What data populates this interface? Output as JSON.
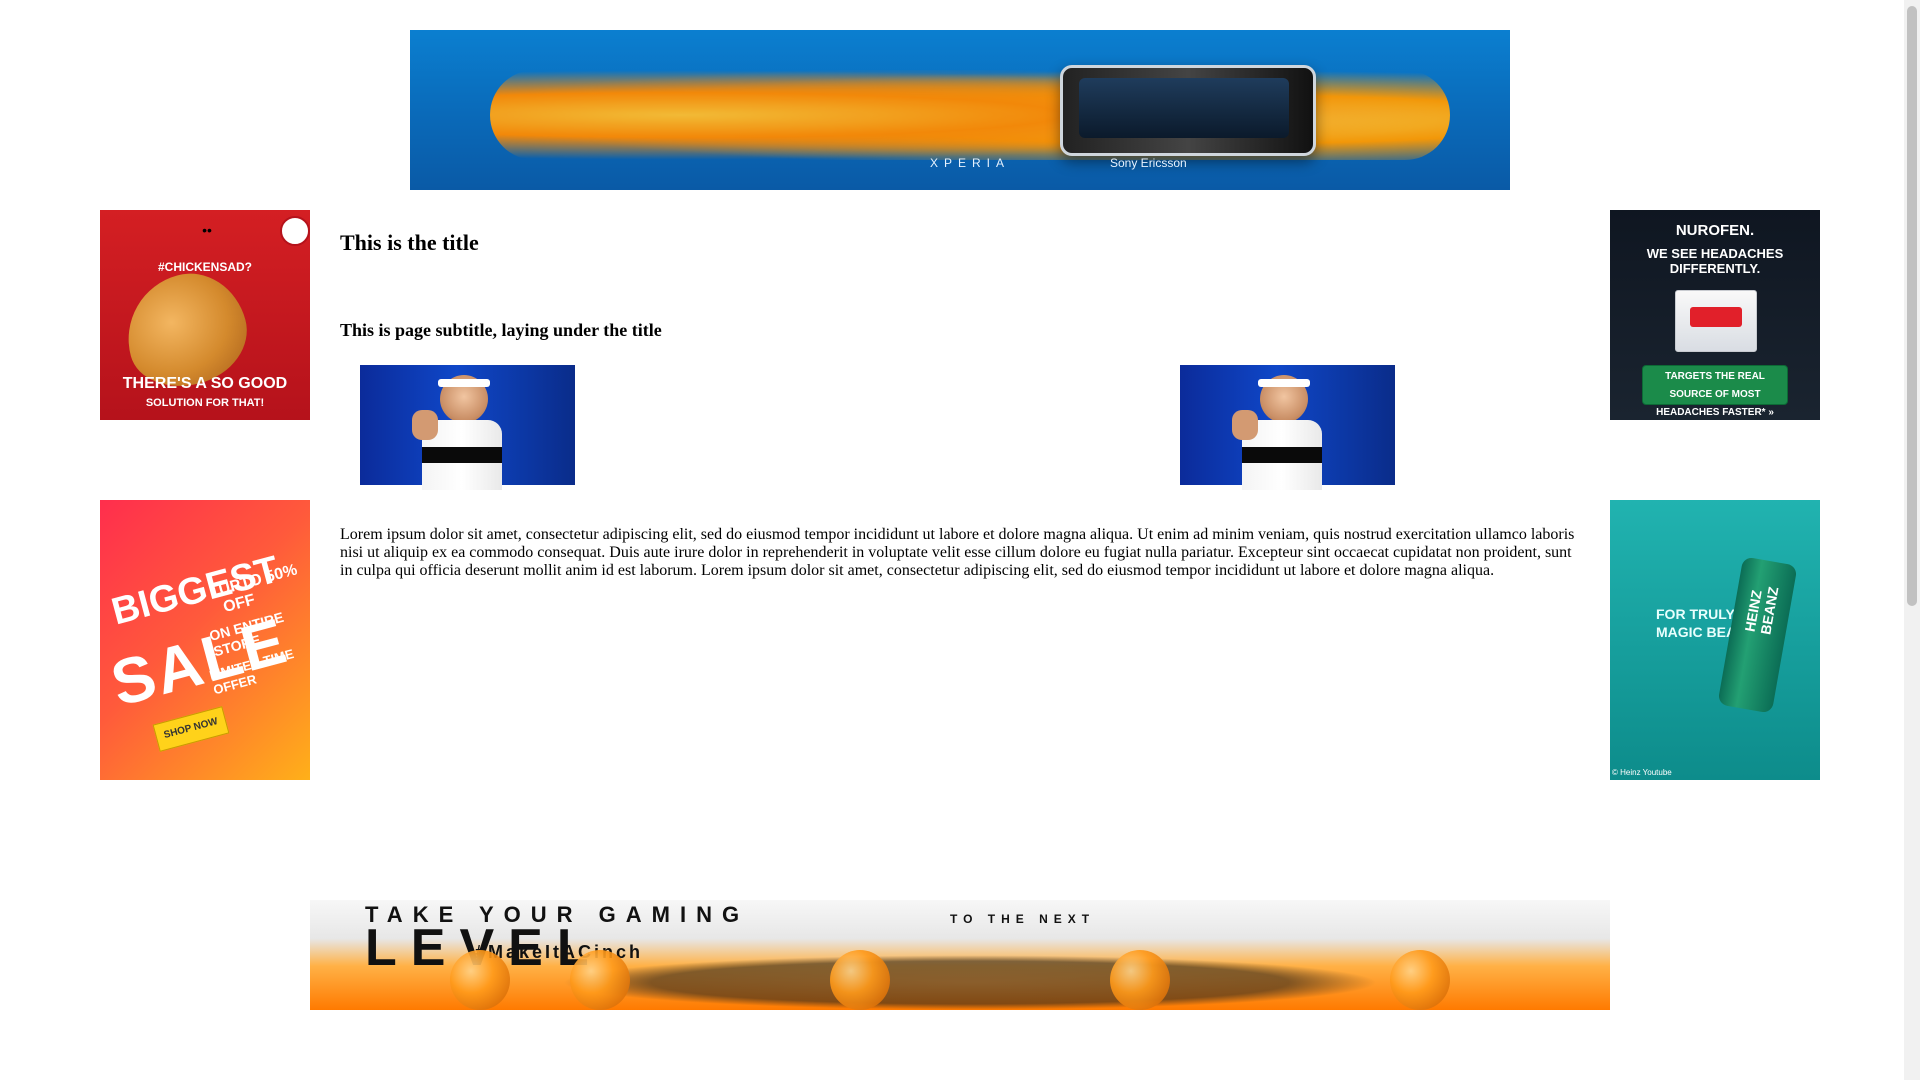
{
  "page": {
    "title": "This is the title",
    "subtitle": "This is page subtitle, laying under the title",
    "body": "Lorem ipsum dolor sit amet, consectetur adipiscing elit, sed do eiusmod tempor incididunt ut labore et dolore magna aliqua. Ut enim ad minim veniam, quis nostrud exercitation ullamco laboris nisi ut aliquip ex ea commodo consequat. Duis aute irure dolor in reprehenderit in voluptate velit esse cillum dolore eu fugiat nulla pariatur. Excepteur sint occaecat cupidatat non proident, sunt in culpa qui officia deserunt mollit anim id est laborum. Lorem ipsum dolor sit amet, consectetur adipiscing elit, sed do eiusmod tempor incididunt ut labore et dolore magna aliqua."
  },
  "ads": {
    "top_banner": {
      "brand": "XPERIA",
      "brand2": "Sony Ericsson"
    },
    "kfc": {
      "hashtag": "#CHICKENSAD?",
      "line1": "THERE'S A SO GOOD",
      "line2": "SOLUTION FOR THAT!"
    },
    "nurofen": {
      "title": "NUROFEN.",
      "subtitle": "WE SEE HEADACHES DIFFERENTLY.",
      "cta": "TARGETS THE REAL SOURCE OF MOST HEADACHES FASTER* »"
    },
    "sale": {
      "biggest": "BIGGEST",
      "sale": "SALE",
      "off": "UPTO 50% OFF",
      "store": "ON ENTIRE STORE",
      "limited": "LIMITED TIME OFFER",
      "shop_now": "SHOP NOW"
    },
    "heinz": {
      "copy_line1": "FOR TRULY",
      "copy_line2": "MAGIC BEANS",
      "can_text": "HEINZ BEANZ",
      "credit": "© Heinz Youtube"
    },
    "bottom_banner": {
      "headline": "TAKE YOUR GAMING",
      "level": "LEVEL",
      "to_the_next": "TO THE NEXT",
      "hashtag": "#MakeItACinch"
    }
  },
  "colors": {
    "background": "#ffffff",
    "text": "#000000",
    "scrollbar_track": "#f1f1f1",
    "scrollbar_thumb": "#c1c1c1"
  }
}
